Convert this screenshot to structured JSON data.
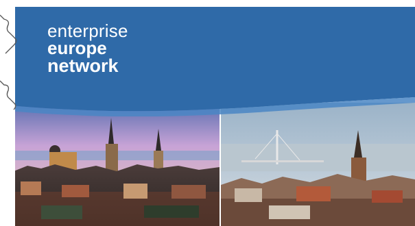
{
  "brand": {
    "line1": "enterprise",
    "line2": "europe",
    "line3": "network",
    "color_banner": "#2f6aa8",
    "color_text": "#ffffff"
  },
  "icons": {
    "left_decoration": "puzzle-outline-icon"
  },
  "photos": {
    "left": "tallinn-skyline-photo",
    "right": "riga-skyline-photo"
  }
}
